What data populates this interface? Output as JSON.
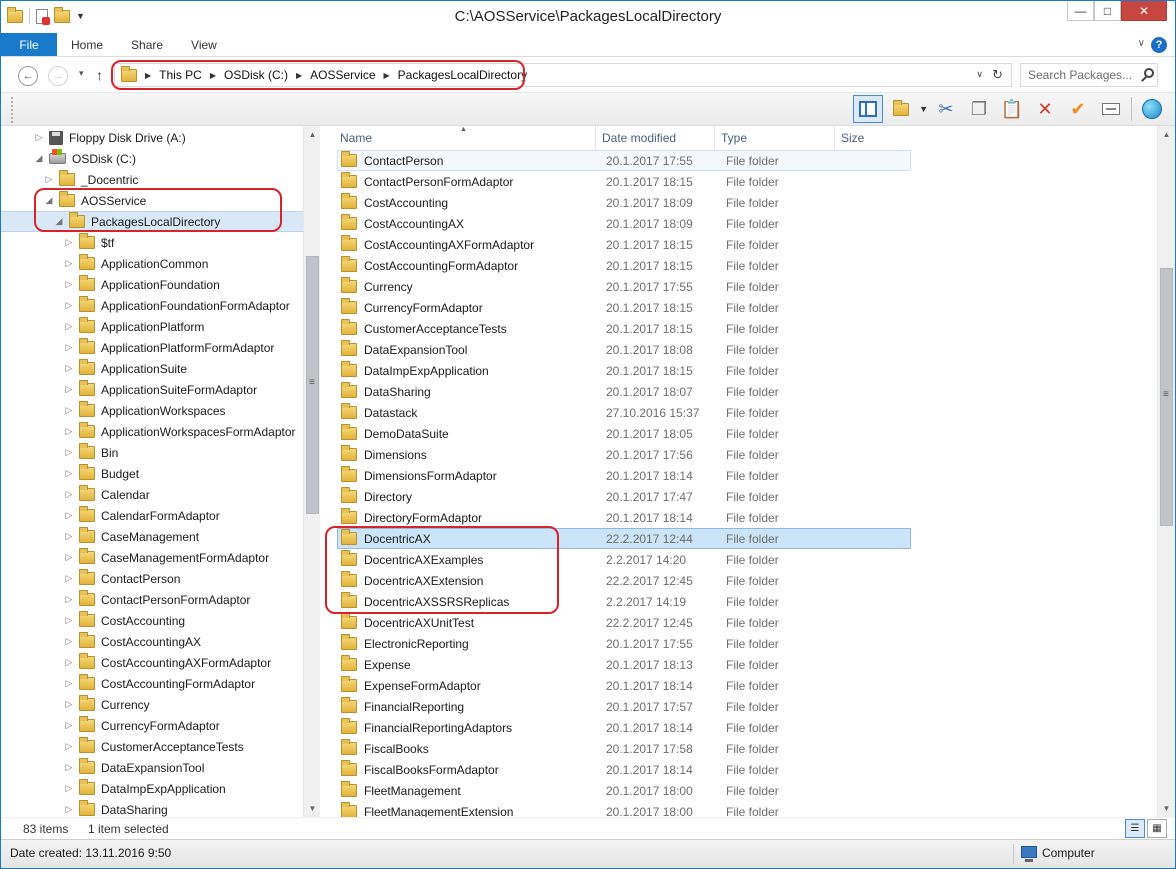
{
  "window": {
    "title": "C:\\AOSService\\PackagesLocalDirectory"
  },
  "ribbon": {
    "tabs": [
      "File",
      "Home",
      "Share",
      "View"
    ]
  },
  "address": {
    "crumbs": [
      "This PC",
      "OSDisk (C:)",
      "AOSService",
      "PackagesLocalDirectory"
    ],
    "search_placeholder": "Search Packages..."
  },
  "tree": [
    {
      "label": "Floppy Disk Drive (A:)",
      "icon": "floppy-drive-icon",
      "indent": 0,
      "arrow": "▷"
    },
    {
      "label": "OSDisk (C:)",
      "icon": "os-drive-icon",
      "indent": 0,
      "arrow": "◢"
    },
    {
      "label": "_Docentric",
      "icon": "folder-icon",
      "indent": 1,
      "arrow": "▷"
    },
    {
      "label": "AOSService",
      "icon": "folder-icon",
      "indent": 1,
      "arrow": "◢"
    },
    {
      "label": "PackagesLocalDirectory",
      "icon": "folder-icon",
      "indent": 2,
      "arrow": "◢",
      "selected": true
    },
    {
      "label": "$tf",
      "icon": "folder-icon",
      "indent": 3,
      "arrow": "▷"
    },
    {
      "label": "ApplicationCommon",
      "icon": "folder-icon",
      "indent": 3,
      "arrow": "▷"
    },
    {
      "label": "ApplicationFoundation",
      "icon": "folder-icon",
      "indent": 3,
      "arrow": "▷"
    },
    {
      "label": "ApplicationFoundationFormAdaptor",
      "icon": "folder-icon",
      "indent": 3,
      "arrow": "▷"
    },
    {
      "label": "ApplicationPlatform",
      "icon": "folder-icon",
      "indent": 3,
      "arrow": "▷"
    },
    {
      "label": "ApplicationPlatformFormAdaptor",
      "icon": "folder-icon",
      "indent": 3,
      "arrow": "▷"
    },
    {
      "label": "ApplicationSuite",
      "icon": "folder-icon",
      "indent": 3,
      "arrow": "▷"
    },
    {
      "label": "ApplicationSuiteFormAdaptor",
      "icon": "folder-icon",
      "indent": 3,
      "arrow": "▷"
    },
    {
      "label": "ApplicationWorkspaces",
      "icon": "folder-icon",
      "indent": 3,
      "arrow": "▷"
    },
    {
      "label": "ApplicationWorkspacesFormAdaptor",
      "icon": "folder-icon",
      "indent": 3,
      "arrow": "▷"
    },
    {
      "label": "Bin",
      "icon": "folder-icon",
      "indent": 3,
      "arrow": "▷"
    },
    {
      "label": "Budget",
      "icon": "folder-icon",
      "indent": 3,
      "arrow": "▷"
    },
    {
      "label": "Calendar",
      "icon": "folder-icon",
      "indent": 3,
      "arrow": "▷"
    },
    {
      "label": "CalendarFormAdaptor",
      "icon": "folder-icon",
      "indent": 3,
      "arrow": "▷"
    },
    {
      "label": "CaseManagement",
      "icon": "folder-icon",
      "indent": 3,
      "arrow": "▷"
    },
    {
      "label": "CaseManagementFormAdaptor",
      "icon": "folder-icon",
      "indent": 3,
      "arrow": "▷"
    },
    {
      "label": "ContactPerson",
      "icon": "folder-icon",
      "indent": 3,
      "arrow": "▷"
    },
    {
      "label": "ContactPersonFormAdaptor",
      "icon": "folder-icon",
      "indent": 3,
      "arrow": "▷"
    },
    {
      "label": "CostAccounting",
      "icon": "folder-icon",
      "indent": 3,
      "arrow": "▷"
    },
    {
      "label": "CostAccountingAX",
      "icon": "folder-icon",
      "indent": 3,
      "arrow": "▷"
    },
    {
      "label": "CostAccountingAXFormAdaptor",
      "icon": "folder-icon",
      "indent": 3,
      "arrow": "▷"
    },
    {
      "label": "CostAccountingFormAdaptor",
      "icon": "folder-icon",
      "indent": 3,
      "arrow": "▷"
    },
    {
      "label": "Currency",
      "icon": "folder-icon",
      "indent": 3,
      "arrow": "▷"
    },
    {
      "label": "CurrencyFormAdaptor",
      "icon": "folder-icon",
      "indent": 3,
      "arrow": "▷"
    },
    {
      "label": "CustomerAcceptanceTests",
      "icon": "folder-icon",
      "indent": 3,
      "arrow": "▷"
    },
    {
      "label": "DataExpansionTool",
      "icon": "folder-icon",
      "indent": 3,
      "arrow": "▷"
    },
    {
      "label": "DataImpExpApplication",
      "icon": "folder-icon",
      "indent": 3,
      "arrow": "▷"
    },
    {
      "label": "DataSharing",
      "icon": "folder-icon",
      "indent": 3,
      "arrow": "▷"
    }
  ],
  "columns": [
    "Name",
    "Date modified",
    "Type",
    "Size"
  ],
  "files": [
    {
      "name": "ContactPerson",
      "date": "20.1.2017 17:55",
      "type": "File folder",
      "state": "hover"
    },
    {
      "name": "ContactPersonFormAdaptor",
      "date": "20.1.2017 18:15",
      "type": "File folder"
    },
    {
      "name": "CostAccounting",
      "date": "20.1.2017 18:09",
      "type": "File folder"
    },
    {
      "name": "CostAccountingAX",
      "date": "20.1.2017 18:09",
      "type": "File folder"
    },
    {
      "name": "CostAccountingAXFormAdaptor",
      "date": "20.1.2017 18:15",
      "type": "File folder"
    },
    {
      "name": "CostAccountingFormAdaptor",
      "date": "20.1.2017 18:15",
      "type": "File folder"
    },
    {
      "name": "Currency",
      "date": "20.1.2017 17:55",
      "type": "File folder"
    },
    {
      "name": "CurrencyFormAdaptor",
      "date": "20.1.2017 18:15",
      "type": "File folder"
    },
    {
      "name": "CustomerAcceptanceTests",
      "date": "20.1.2017 18:15",
      "type": "File folder"
    },
    {
      "name": "DataExpansionTool",
      "date": "20.1.2017 18:08",
      "type": "File folder"
    },
    {
      "name": "DataImpExpApplication",
      "date": "20.1.2017 18:15",
      "type": "File folder"
    },
    {
      "name": "DataSharing",
      "date": "20.1.2017 18:07",
      "type": "File folder"
    },
    {
      "name": "Datastack",
      "date": "27.10.2016 15:37",
      "type": "File folder"
    },
    {
      "name": "DemoDataSuite",
      "date": "20.1.2017 18:05",
      "type": "File folder"
    },
    {
      "name": "Dimensions",
      "date": "20.1.2017 17:56",
      "type": "File folder"
    },
    {
      "name": "DimensionsFormAdaptor",
      "date": "20.1.2017 18:14",
      "type": "File folder"
    },
    {
      "name": "Directory",
      "date": "20.1.2017 17:47",
      "type": "File folder"
    },
    {
      "name": "DirectoryFormAdaptor",
      "date": "20.1.2017 18:14",
      "type": "File folder"
    },
    {
      "name": "DocentricAX",
      "date": "22.2.2017 12:44",
      "type": "File folder",
      "state": "selected"
    },
    {
      "name": "DocentricAXExamples",
      "date": "2.2.2017 14:20",
      "type": "File folder"
    },
    {
      "name": "DocentricAXExtension",
      "date": "22.2.2017 12:45",
      "type": "File folder"
    },
    {
      "name": "DocentricAXSSRSReplicas",
      "date": "2.2.2017 14:19",
      "type": "File folder"
    },
    {
      "name": "DocentricAXUnitTest",
      "date": "22.2.2017 12:45",
      "type": "File folder"
    },
    {
      "name": "ElectronicReporting",
      "date": "20.1.2017 17:55",
      "type": "File folder"
    },
    {
      "name": "Expense",
      "date": "20.1.2017 18:13",
      "type": "File folder"
    },
    {
      "name": "ExpenseFormAdaptor",
      "date": "20.1.2017 18:14",
      "type": "File folder"
    },
    {
      "name": "FinancialReporting",
      "date": "20.1.2017 17:57",
      "type": "File folder"
    },
    {
      "name": "FinancialReportingAdaptors",
      "date": "20.1.2017 18:14",
      "type": "File folder"
    },
    {
      "name": "FiscalBooks",
      "date": "20.1.2017 17:58",
      "type": "File folder"
    },
    {
      "name": "FiscalBooksFormAdaptor",
      "date": "20.1.2017 18:14",
      "type": "File folder"
    },
    {
      "name": "FleetManagement",
      "date": "20.1.2017 18:00",
      "type": "File folder"
    },
    {
      "name": "FleetManagementExtension",
      "date": "20.1.2017 18:00",
      "type": "File folder"
    }
  ],
  "status": {
    "items_count": "83 items",
    "selected": "1 item selected",
    "date_created": "Date created: 13.11.2016 9:50",
    "location": "Computer"
  },
  "colors": {
    "accent": "#1979ca",
    "highlight_ring": "#d8232a",
    "selection": "#cce4f7"
  }
}
